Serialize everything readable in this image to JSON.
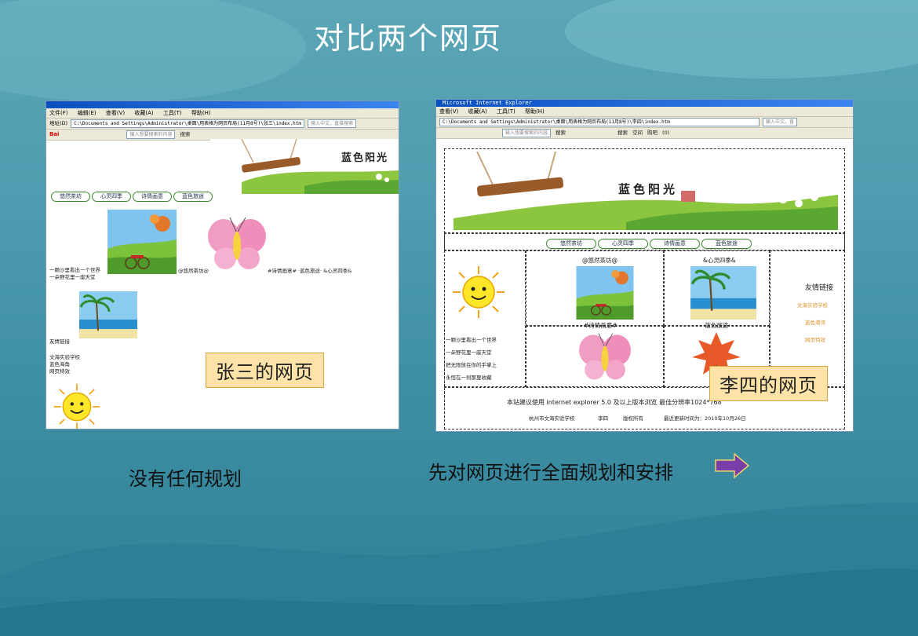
{
  "slide": {
    "title": "对比两个网页",
    "left_caption": "没有任何规划",
    "right_caption": "先对网页进行全面规划和安排",
    "left_label": "张三的网页",
    "right_label": "李四的网页"
  },
  "left_browser": {
    "menu": [
      "文件(F)",
      "编辑(E)",
      "查看(V)",
      "收藏(A)",
      "工具(T)",
      "帮助(H)"
    ],
    "address_label": "地址(D)",
    "address": "C:\\Documents and Settings\\Administrator\\桌面\\用表格为网页布局(11月8号)\\张三\\index.htm",
    "search_placeholder": "输入中文，直接搜索",
    "baidu_label": "Bai",
    "search_box_text": "输入想要搜索的内容",
    "search_btn": "搜索",
    "banner_title": "蓝色阳光",
    "nav": [
      "悠然茶坊",
      "心灵四季",
      "诗情画意",
      "蓝色旅途"
    ],
    "caption_row": "@悠然茶坊@",
    "caption_row2": "#诗情画意# ·蓝色旅途· &心灵四季&",
    "poem": [
      "一颗沙里看出一个世界",
      "一朵野花里一座天堂"
    ],
    "links_title": "友情链接",
    "links": [
      "文海实验学校",
      "蓝色海角",
      "网页特效"
    ]
  },
  "right_browser": {
    "titlebar": "Microsoft Internet Explorer",
    "menu": [
      "查看(V)",
      "收藏(A)",
      "工具(T)",
      "帮助(H)"
    ],
    "address": "C:\\Documents and Settings\\Administrator\\桌面\\用表格为网页布局(11月8号)\\李四\\index.htm",
    "search_placeholder": "输入中文，直",
    "search_box_text": "输入想要搜索的内容",
    "toolbar": [
      "搜索",
      "搜索",
      "空间",
      "购吧",
      "(0)"
    ],
    "banner_title": "蓝色阳光",
    "nav": [
      "悠然茶坊",
      "心灵四季",
      "诗情画意",
      "蓝色旅途"
    ],
    "cell_titles": [
      "@悠然茶坊@",
      "&心灵四季&",
      "#诗情画意#",
      "·蓝色旅途·"
    ],
    "poem": [
      "一颗沙里看出一个世界",
      "一朵野花里一座天堂",
      "把无限放在你的手掌上",
      "永恒在一刹那里收藏"
    ],
    "links_title": "友情链接",
    "links": [
      "文海实验学校",
      "蓝色港湾",
      "网页特效"
    ],
    "footer1": "本站建议使用 internet explorer 5.0 及以上版本浏览  最佳分辨率1024*768",
    "footer2": [
      "杭州市文海实验学校",
      "李四",
      "版权所有",
      "最近更新时间为：2010年10月26日"
    ]
  },
  "colors": {
    "accent_arrow": "#7a3ea8",
    "label_bg": "#fde3a7",
    "nav_border": "#3a8a2c"
  }
}
